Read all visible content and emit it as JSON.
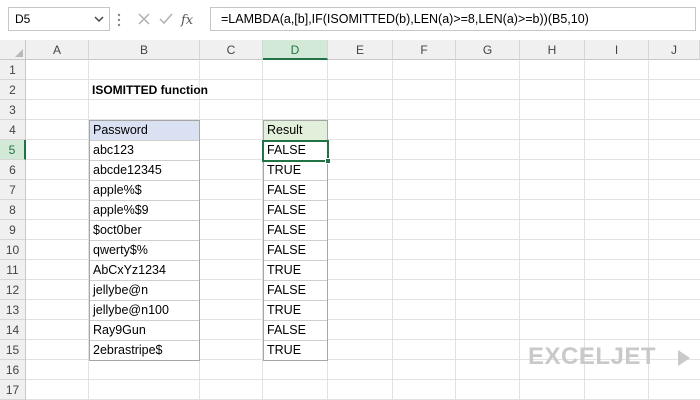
{
  "formula_bar": {
    "name_box": "D5",
    "formula": "=LAMBDA(a,[b],IF(ISOMITTED(b),LEN(a)>=8,LEN(a)>=b))(B5,10)"
  },
  "columns": [
    "A",
    "B",
    "C",
    "D",
    "E",
    "F",
    "G",
    "H",
    "I",
    "J"
  ],
  "rows": [
    "1",
    "2",
    "3",
    "4",
    "5",
    "6",
    "7",
    "8",
    "9",
    "10",
    "11",
    "12",
    "13",
    "14",
    "15",
    "16",
    "17"
  ],
  "active_cell": {
    "column": "D",
    "row": "5"
  },
  "sheet": {
    "title": "ISOMITTED function",
    "password_header": "Password",
    "result_header": "Result",
    "passwords": [
      "abc123",
      "abcde12345",
      "apple%$",
      "apple%$9",
      "$oct0ber",
      "qwerty$%",
      "AbCxYz1234",
      "jellybe@n",
      "jellybe@n100",
      "Ray9Gun",
      "2ebrastripe$"
    ],
    "results": [
      "FALSE",
      "TRUE",
      "FALSE",
      "FALSE",
      "FALSE",
      "FALSE",
      "TRUE",
      "FALSE",
      "TRUE",
      "FALSE",
      "TRUE"
    ]
  },
  "branding": {
    "logo_text": "EXCELJET"
  },
  "colors": {
    "accent": "#217346",
    "password_header_bg": "#d9e1f2",
    "result_header_bg": "#e2efda",
    "logo": "#c9c9c9"
  }
}
